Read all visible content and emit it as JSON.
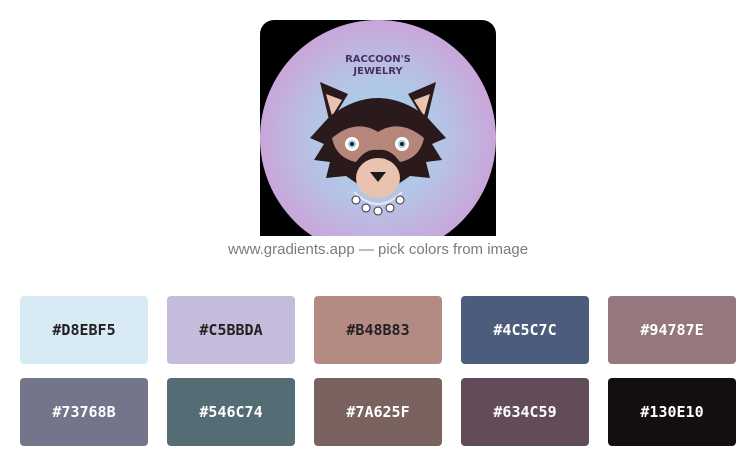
{
  "image": {
    "logo_line1": "RACCOON'S",
    "logo_line2": "JEWELRY",
    "icon": "raccoon-logo-icon"
  },
  "caption": "www.gradients.app — pick colors from image",
  "swatches": [
    {
      "hex": "#D8EBF5",
      "color": "#D8EBF5",
      "text_color": "#222222"
    },
    {
      "hex": "#C5BBDA",
      "color": "#C5BBDA",
      "text_color": "#222222"
    },
    {
      "hex": "#B48B83",
      "color": "#B48B83",
      "text_color": "#222222"
    },
    {
      "hex": "#4C5C7C",
      "color": "#4C5C7C",
      "text_color": "#ffffff"
    },
    {
      "hex": "#94787E",
      "color": "#94787E",
      "text_color": "#ffffff"
    },
    {
      "hex": "#73768B",
      "color": "#73768B",
      "text_color": "#ffffff"
    },
    {
      "hex": "#546C74",
      "color": "#546C74",
      "text_color": "#ffffff"
    },
    {
      "hex": "#7A625F",
      "color": "#7A625F",
      "text_color": "#ffffff"
    },
    {
      "hex": "#634C59",
      "color": "#634C59",
      "text_color": "#ffffff"
    },
    {
      "hex": "#130E10",
      "color": "#130E10",
      "text_color": "#ffffff"
    }
  ]
}
